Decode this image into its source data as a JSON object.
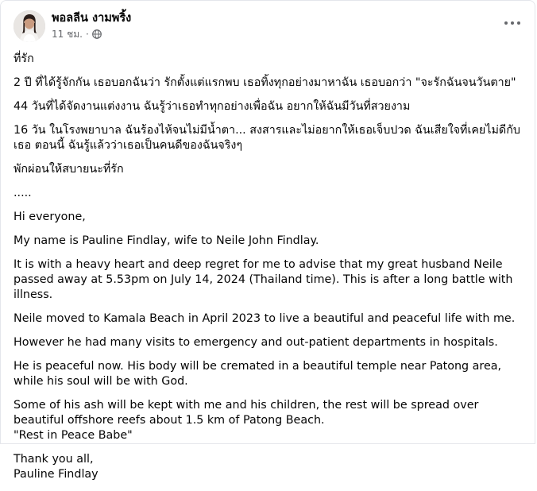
{
  "author": {
    "name": "พอลลีน งามพริ้ง",
    "time": "11 ชม.",
    "privacy_icon": "globe-icon"
  },
  "post": {
    "paragraphs": [
      "ที่รัก",
      "2 ปี ที่ได้รู้จักกัน เธอบอกฉันว่า รักตั้งแต่แรกพบ เธอทิ้งทุกอย่างมาหาฉัน เธอบอกว่า \"จะรักฉันจนวันตาย\"",
      "44 วันที่ได้จัดงานแต่งงาน ฉันรู้ว่าเธอทำทุกอย่างเพื่อฉัน อยากให้ฉันมีวันที่สวยงาม",
      "16 วัน ในโรงพยาบาล ฉันร้องไห้จนไม่มีน้ำตา... สงสารและไม่อยากให้เธอเจ็บปวด ฉันเสียใจที่เคยไม่ดีกับเธอ ตอนนี้ ฉันรู้แล้วว่าเธอเป็นคนดีของฉันจริงๆ",
      "พักผ่อนให้สบายนะที่รัก",
      ".....",
      "Hi everyone,",
      "My name is Pauline Findlay, wife to Neile John Findlay.",
      "It is with a heavy heart and deep regret for me to advise that my great husband Neile passed away at 5.53pm on July 14, 2024 (Thailand time). This is after a long battle with illness.",
      "Neile moved to Kamala Beach in April 2023 to live a beautiful and peaceful life with me.",
      "However he had many visits to emergency and out-patient departments in hospitals.",
      "He is peaceful now. His body will be cremated in a beautiful temple near Patong area, while his soul will be with God.",
      "Some of his ash will be kept with me and his children, the rest will be spread over beautiful offshore reefs about 1.5 km of Patong Beach.",
      "\"Rest in Peace Babe\"",
      "Thank you all,",
      "Pauline Findlay"
    ]
  },
  "menu": {
    "more_icon": "more-horizontal-icon"
  }
}
